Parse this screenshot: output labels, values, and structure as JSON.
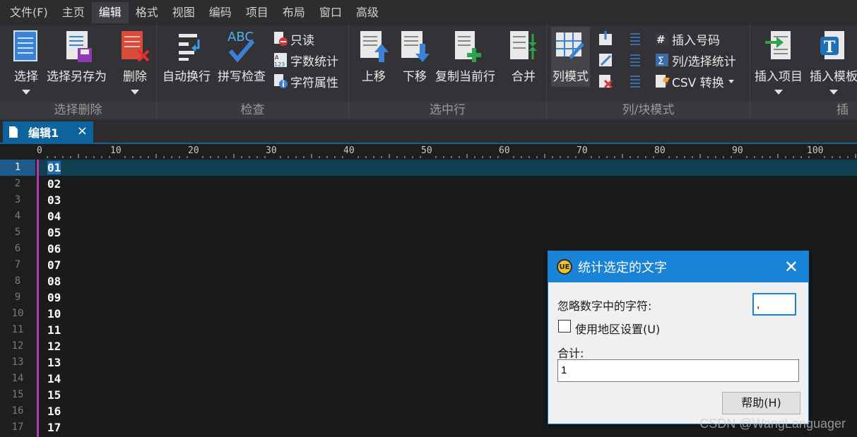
{
  "menu": [
    "文件(F)",
    "主页",
    "编辑",
    "格式",
    "视图",
    "编码",
    "项目",
    "布局",
    "窗口",
    "高级"
  ],
  "menu_active": 2,
  "ribbon": {
    "select_group": {
      "label": "选择删除",
      "select": "选择",
      "select_save_as": "选择另存为",
      "delete": "删除"
    },
    "check_group": {
      "label": "检查",
      "auto_wrap": "自动换行",
      "spell_check": "拼写检查",
      "read_only": "只读",
      "word_count": "字数统计",
      "char_props": "字符属性"
    },
    "line_group": {
      "label": "选中行",
      "move_up": "上移",
      "move_down": "下移",
      "duplicate_line": "复制当前行",
      "merge": "合并"
    },
    "column_group": {
      "label": "列/块模式",
      "column_mode": "列模式",
      "insert_number": "插入号码",
      "column_stats": "列/选择统计",
      "csv_convert": "CSV 转换"
    },
    "insert_group": {
      "label": "插入",
      "insert_item": "插入项目",
      "insert_template": "插入模板"
    }
  },
  "tab": {
    "label": "编辑1",
    "close": "×"
  },
  "ruler": [
    "0",
    "10",
    "20",
    "30",
    "40",
    "50",
    "60",
    "70",
    "80",
    "90",
    "100"
  ],
  "line_numbers": [
    "1",
    "2",
    "3",
    "4",
    "5",
    "6",
    "7",
    "8",
    "9",
    "10",
    "11",
    "12",
    "13",
    "14",
    "15",
    "16",
    "17"
  ],
  "lines": [
    "01",
    "02",
    "03",
    "04",
    "05",
    "06",
    "07",
    "08",
    "09",
    "10",
    "11",
    "12",
    "13",
    "14",
    "15",
    "16",
    "17"
  ],
  "dialog": {
    "title": "统计选定的文字",
    "logo": "UE",
    "ignore_label": "忽略数字中的字符:",
    "ignore_value": ",",
    "locale_label": "使用地区设置(U)",
    "total_label": "合计:",
    "total_value": "1",
    "help_button": "帮助(H)"
  },
  "watermark": "CSDN @WangLanguager"
}
